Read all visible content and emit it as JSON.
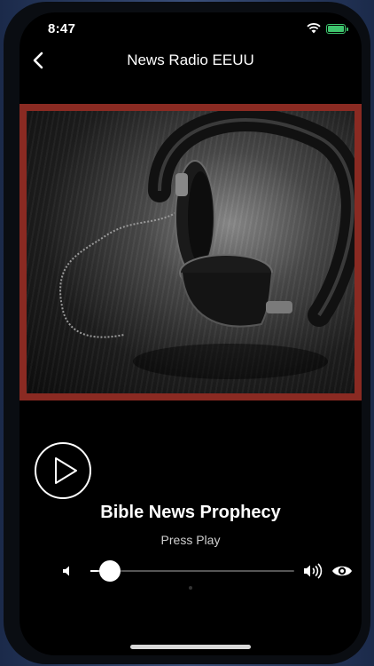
{
  "status_bar": {
    "time": "8:47"
  },
  "navbar": {
    "title": "News Radio EEUU",
    "back_icon": "chevron-left-icon"
  },
  "player": {
    "title": "Bible News Prophecy",
    "status": "Press Play",
    "volume_level": 0.05,
    "accent_frame_color": "#8a2a22"
  },
  "icons": [
    "chevron-left-icon",
    "wifi-icon",
    "battery-icon",
    "headphones-artwork",
    "play-icon",
    "volume-low-icon",
    "volume-high-icon",
    "eye-icon"
  ]
}
